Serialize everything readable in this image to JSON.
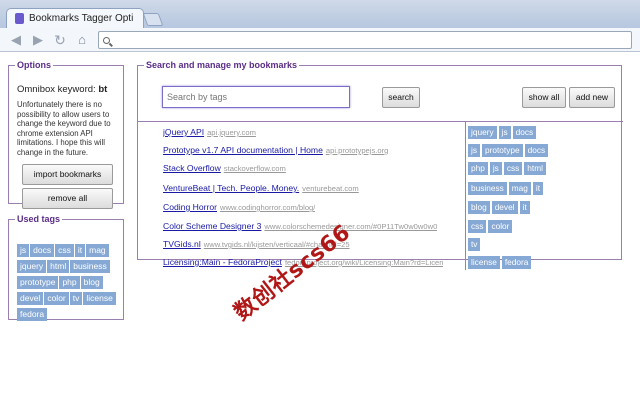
{
  "browser": {
    "tab_title": "Bookmarks Tagger Opti",
    "tab_close": "×",
    "url": ""
  },
  "options": {
    "title": "Options",
    "omnibox_prefix": "Omnibox keyword: ",
    "omnibox_keyword": "bt",
    "note": "Unfortunately there is no possibility to allow users to change the keyword due to chrome extension API limitations. I hope this will change in the future.",
    "import_label": "import bookmarks",
    "remove_label": "remove all"
  },
  "used_tags": {
    "title": "Used tags",
    "tags": [
      "js",
      "docs",
      "css",
      "it",
      "mag",
      "jquery",
      "html",
      "business",
      "prototype",
      "php",
      "blog",
      "devel",
      "color",
      "tv",
      "license",
      "fedora"
    ]
  },
  "main": {
    "title": "Search and manage my bookmarks",
    "search_placeholder": "Search by tags",
    "search_label": "search",
    "show_all_label": "show all",
    "add_new_label": "add new",
    "bookmarks": [
      {
        "title": "jQuery API",
        "url": "api.jquery.com",
        "tags": [
          "jquery",
          "js",
          "docs"
        ]
      },
      {
        "title": "Prototype v1.7 API documentation | Home",
        "url": "api.prototypejs.org",
        "tags": [
          "js",
          "prototype",
          "docs"
        ]
      },
      {
        "title": "Stack Overflow",
        "url": "stackoverflow.com",
        "tags": [
          "php",
          "js",
          "css",
          "html"
        ]
      },
      {
        "title": "VentureBeat | Tech. People. Money.",
        "url": "venturebeat.com",
        "tags": [
          "business",
          "mag",
          "it"
        ]
      },
      {
        "title": "Coding Horror",
        "url": "www.codinghorror.com/blog/",
        "tags": [
          "blog",
          "devel",
          "it"
        ]
      },
      {
        "title": "Color Scheme Designer 3",
        "url": "www.colorschemedesigner.com/#0P11Tw0w0w0w0",
        "tags": [
          "css",
          "color"
        ]
      },
      {
        "title": "TVGids.nl",
        "url": "www.tvgids.nl/kijsten/verticaal/#channel=25",
        "tags": [
          "tv"
        ]
      },
      {
        "title": "Licensing:Main - FedoraProject",
        "url": "fedoraproject.org/wiki/Licensing:Main?rd=Licen",
        "tags": [
          "license",
          "fedora"
        ]
      }
    ]
  },
  "watermark": "数创社scs66"
}
